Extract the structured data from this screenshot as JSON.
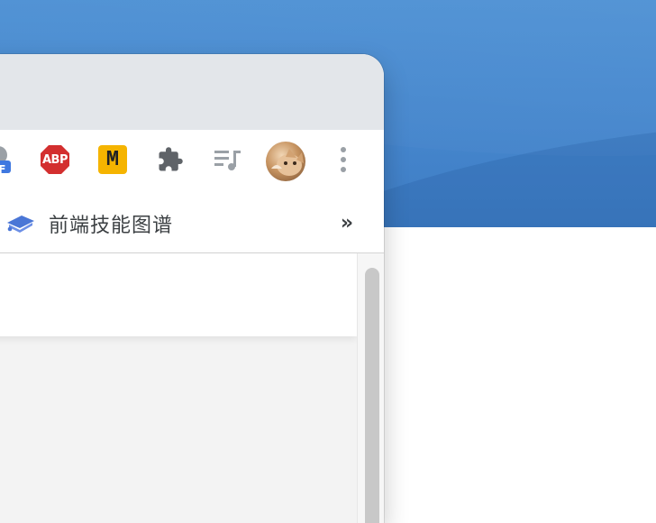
{
  "toolbar": {
    "extensions": [
      {
        "name": "off-badge-extension",
        "badge_text": "FF"
      },
      {
        "name": "adblock-plus-extension",
        "text": "ABP"
      },
      {
        "name": "m-extension",
        "text": "M"
      },
      {
        "name": "puzzle-extension"
      },
      {
        "name": "media-queue-extension"
      },
      {
        "name": "profile-avatar"
      },
      {
        "name": "more-menu"
      }
    ],
    "abp_color": "#d32f2f",
    "m_color": "#f5b400",
    "badge_color": "#3f78e0"
  },
  "bookmarks": {
    "item_label": "前端技能图谱",
    "overflow_label": "»"
  }
}
